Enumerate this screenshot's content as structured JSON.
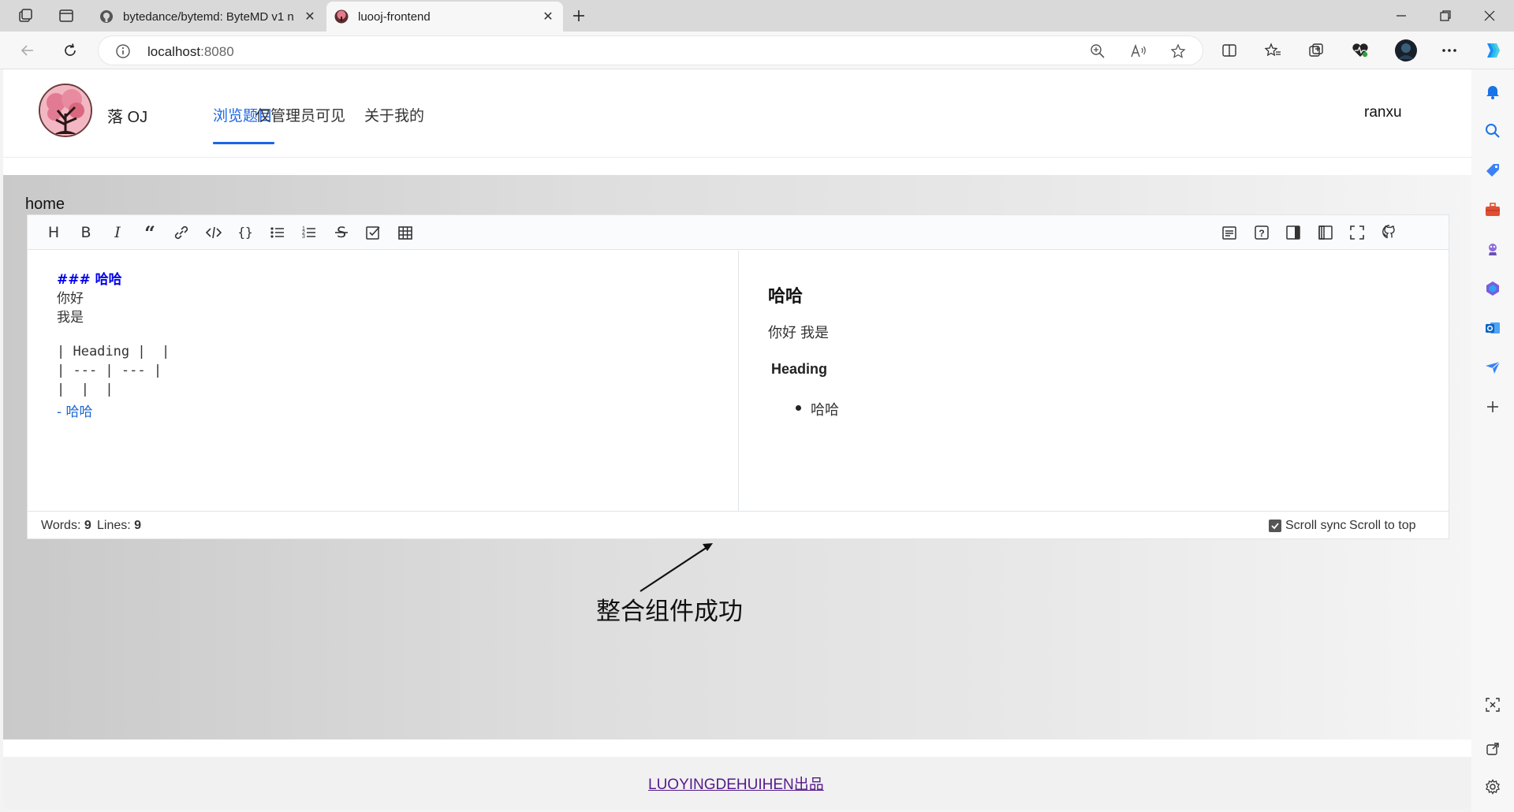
{
  "browser": {
    "tabs": [
      {
        "title": "bytedance/bytemd: ByteMD v1 n",
        "active": false
      },
      {
        "title": "luooj-frontend",
        "active": true
      }
    ],
    "address": {
      "host": "localhost",
      "port": ":8080"
    }
  },
  "site": {
    "brand": "落 OJ",
    "menu": [
      "浏览题目",
      "仅管理员可见",
      "关于我的"
    ],
    "active_menu_index": 0,
    "username": "ranxu"
  },
  "page": {
    "breadcrumb": "home"
  },
  "editor": {
    "toolbar_left": [
      "heading-icon",
      "bold-icon",
      "italic-icon",
      "quote-icon",
      "link-icon",
      "code-icon",
      "code-block-icon",
      "unordered-list-icon",
      "ordered-list-icon",
      "strikethrough-icon",
      "task-list-icon",
      "table-icon"
    ],
    "toolbar_right": [
      "toc-icon",
      "help-icon",
      "preview-only-icon",
      "write-only-icon",
      "fullscreen-icon",
      "github-icon"
    ],
    "source_lines": [
      "### 哈哈",
      "你好",
      "我是",
      "",
      "| Heading |  |",
      "| --- | --- |",
      "|  |  |",
      "- 哈哈"
    ],
    "preview": {
      "heading": "哈哈",
      "paragraph": "你好 我是",
      "table_header": "Heading",
      "list_item": "哈哈"
    },
    "status": {
      "words_label": "Words:",
      "words": "9",
      "lines_label": "Lines:",
      "lines": "9",
      "scroll_sync": "Scroll sync",
      "scroll_top": "Scroll to top"
    }
  },
  "annotation": "整合组件成功",
  "footer": {
    "link": "LUOYINGDEHUIHEN出品"
  },
  "colors": {
    "accent": "#1b66e6",
    "md_heading": "#0000ee",
    "md_list": "#1a66cc",
    "footer_link": "#551a8b"
  }
}
